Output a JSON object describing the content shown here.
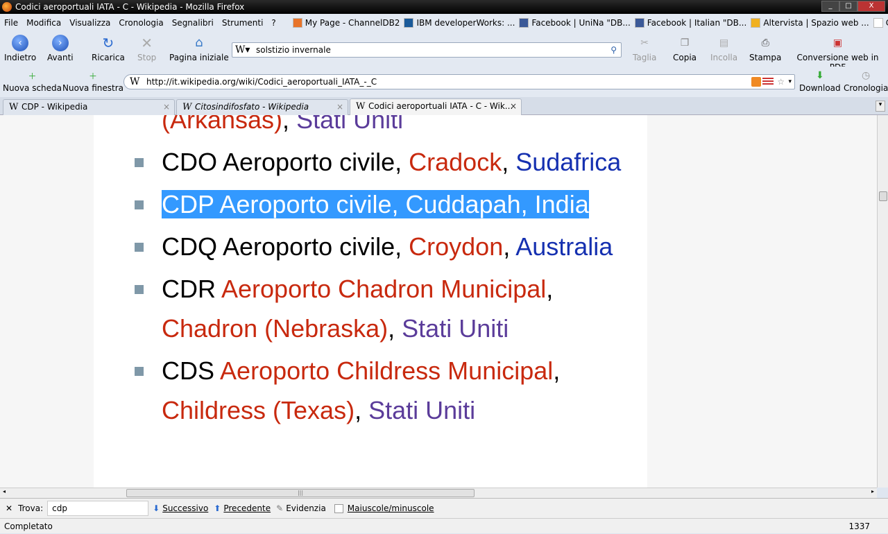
{
  "window": {
    "title": "Codici aeroportuali IATA - C - Wikipedia - Mozilla Firefox"
  },
  "menu": [
    "File",
    "Modifica",
    "Visualizza",
    "Cronologia",
    "Segnalibri",
    "Strumenti",
    "?"
  ],
  "bookmarks": [
    {
      "label": "My Page - ChannelDB2",
      "icon": "channeldb2-icon",
      "color": "#e8742a"
    },
    {
      "label": "IBM developerWorks: ...",
      "icon": "ibm-icon",
      "color": "#1a5a9a"
    },
    {
      "label": "Facebook | UniNa \"DB...",
      "icon": "facebook-icon",
      "color": "#3b5998"
    },
    {
      "label": "Facebook | Italian \"DB...",
      "icon": "facebook-icon",
      "color": "#3b5998"
    },
    {
      "label": "Altervista | Spazio web ...",
      "icon": "altervista-icon",
      "color": "#f0b020"
    },
    {
      "label": "Cdp Home",
      "icon": "page-icon",
      "color": "#ffffff"
    }
  ],
  "toolbar": {
    "back": "Indietro",
    "forward": "Avanti",
    "reload": "Ricarica",
    "stop": "Stop",
    "home": "Pagina iniziale",
    "cut": "Taglia",
    "copy": "Copia",
    "paste": "Incolla",
    "print": "Stampa",
    "pdf": "Conversione web in PDF",
    "new_tab": "Nuova scheda",
    "new_window": "Nuova finestra",
    "download": "Download",
    "history": "Cronologia"
  },
  "search": {
    "value": "solstizio invernale"
  },
  "url": {
    "value": "http://it.wikipedia.org/wiki/Codici_aeroportuali_IATA_-_C"
  },
  "tabs": [
    {
      "label": "CDP - Wikipedia",
      "active": false
    },
    {
      "label": "Citosindifosfato - Wikipedia",
      "active": false
    },
    {
      "label": "Codici aeroportuali IATA - C - Wik...",
      "active": true
    }
  ],
  "colors": {
    "red_link": "#c8290e",
    "blue_link": "#1530b0",
    "visited_link": "#5b3c9a",
    "selection": "#3399ff"
  },
  "list": [
    {
      "bullet": false,
      "segments": [
        {
          "t": "(Arkansas)",
          "c": "red"
        },
        {
          "t": ", ",
          "c": "black"
        },
        {
          "t": "Stati Uniti",
          "c": "purple"
        }
      ]
    },
    {
      "bullet": true,
      "segments": [
        {
          "t": "CDO Aeroporto civile, ",
          "c": "black"
        },
        {
          "t": "Cradock",
          "c": "red"
        },
        {
          "t": ", ",
          "c": "black"
        },
        {
          "t": "Sudafrica",
          "c": "blue"
        }
      ]
    },
    {
      "bullet": true,
      "selected": true,
      "segments": [
        {
          "t": "CDP Aeroporto civile, Cuddapah, India",
          "c": "black"
        }
      ]
    },
    {
      "bullet": true,
      "segments": [
        {
          "t": "CDQ Aeroporto civile, ",
          "c": "black"
        },
        {
          "t": "Croydon",
          "c": "red"
        },
        {
          "t": ", ",
          "c": "black"
        },
        {
          "t": "Australia",
          "c": "blue"
        }
      ]
    },
    {
      "bullet": true,
      "segments": [
        {
          "t": "CDR ",
          "c": "black"
        },
        {
          "t": "Aeroporto Chadron Municipal",
          "c": "red"
        },
        {
          "t": ", ",
          "c": "black"
        },
        {
          "t": "Chadron (Nebraska)",
          "c": "red"
        },
        {
          "t": ", ",
          "c": "black"
        },
        {
          "t": "Stati Uniti",
          "c": "purple"
        }
      ]
    },
    {
      "bullet": true,
      "segments": [
        {
          "t": "CDS ",
          "c": "black"
        },
        {
          "t": "Aeroporto Childress Municipal",
          "c": "red"
        },
        {
          "t": ", ",
          "c": "black"
        },
        {
          "t": "Childress (Texas)",
          "c": "red"
        },
        {
          "t": ", ",
          "c": "black"
        },
        {
          "t": "Stati Uniti",
          "c": "purple"
        }
      ]
    }
  ],
  "findbar": {
    "label": "Trova:",
    "value": "cdp",
    "next": "Successivo",
    "prev": "Precedente",
    "highlight": "Evidenzia",
    "match_case": "Maiuscole/minuscole",
    "match_case_checked": false
  },
  "status": {
    "text": "Completato",
    "right": "1337"
  }
}
